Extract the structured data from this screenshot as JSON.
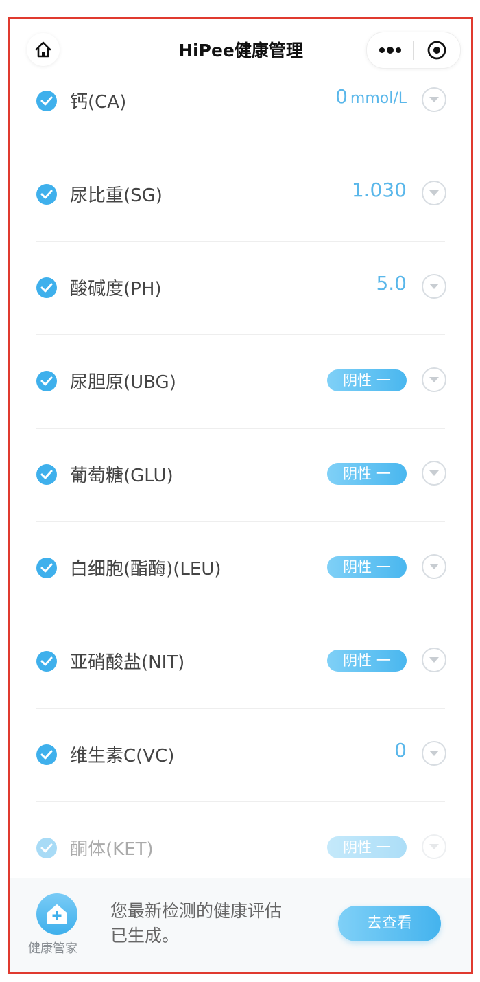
{
  "header": {
    "title": "HiPee健康管理"
  },
  "items": [
    {
      "label": "钙(CA)",
      "value": "0",
      "unit": "mmol/L",
      "type": "value"
    },
    {
      "label": "尿比重(SG)",
      "value": "1.030",
      "type": "value"
    },
    {
      "label": "酸碱度(PH)",
      "value": "5.0",
      "type": "value"
    },
    {
      "label": "尿胆原(UBG)",
      "value": "阴性 一",
      "type": "badge"
    },
    {
      "label": "葡萄糖(GLU)",
      "value": "阴性 一",
      "type": "badge"
    },
    {
      "label": "白细胞(酯酶)(LEU)",
      "value": "阴性 一",
      "type": "badge"
    },
    {
      "label": "亚硝酸盐(NIT)",
      "value": "阴性 一",
      "type": "badge"
    },
    {
      "label": "维生素C(VC)",
      "value": "0",
      "type": "value"
    },
    {
      "label": "酮体(KET)",
      "value": "阴性 一",
      "type": "badge"
    }
  ],
  "bottom_bar": {
    "icon_label": "健康管家",
    "message_line1": "您最新检测的健康评估",
    "message_line2": "已生成。",
    "button_label": "去查看"
  },
  "colors": {
    "accent": "#3fb0ec",
    "value_text": "#5ab7ea",
    "frame_border": "#e03a2f"
  }
}
